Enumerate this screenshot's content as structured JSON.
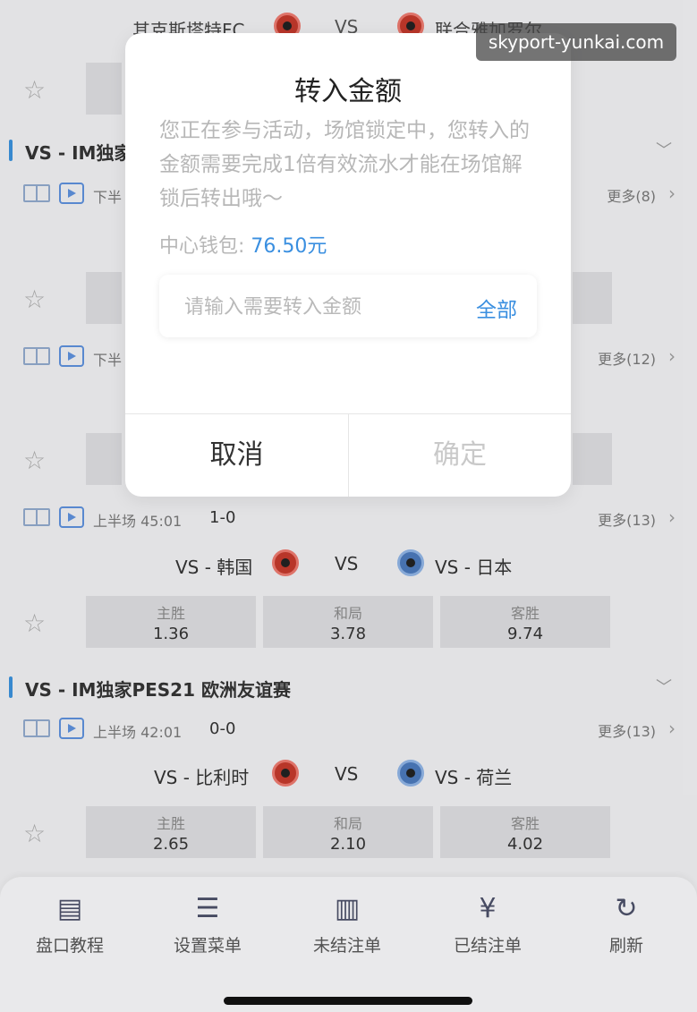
{
  "watermark": "skyport-yunkai.com",
  "top_match": {
    "home": "其克斯塔特FC",
    "vs": "VS",
    "away": "联合雅加罗尔"
  },
  "leagues": [
    {
      "name": "VS - IM独家"
    },
    {
      "name": "VS - IM独家PES21 欧洲友谊赛"
    }
  ],
  "rows": [
    {
      "period": "下半",
      "more": "更多(8)"
    },
    {
      "period": "下半",
      "more": "更多(12)"
    }
  ],
  "match1": {
    "period": "上半场 45:01",
    "score": "1-0",
    "more": "更多(13)",
    "home": "VS - 韩国",
    "vs": "VS",
    "away": "VS - 日本",
    "odds": [
      {
        "label": "主胜",
        "value": "1.36"
      },
      {
        "label": "和局",
        "value": "3.78"
      },
      {
        "label": "客胜",
        "value": "9.74"
      }
    ]
  },
  "match2": {
    "period": "上半场 42:01",
    "score": "0-0",
    "more": "更多(13)",
    "home": "VS - 比利时",
    "vs": "VS",
    "away": "VS - 荷兰",
    "odds": [
      {
        "label": "主胜",
        "value": "2.65"
      },
      {
        "label": "和局",
        "value": "2.10"
      },
      {
        "label": "客胜",
        "value": "4.02"
      }
    ]
  },
  "modal": {
    "title": "转入金额",
    "message": "您正在参与活动，场馆锁定中，您转入的金额需要完成1倍有效流水才能在场馆解锁后转出哦～",
    "wallet_label": "中心钱包:",
    "wallet_amount": "76.50元",
    "input_placeholder": "请输入需要转入金额",
    "all_label": "全部",
    "cancel_label": "取消",
    "confirm_label": "确定"
  },
  "bottom_nav": [
    {
      "label": "盘口教程",
      "icon": "document-icon"
    },
    {
      "label": "设置菜单",
      "icon": "sliders-icon"
    },
    {
      "label": "未结注单",
      "icon": "clipboard-icon"
    },
    {
      "label": "已结注单",
      "icon": "yen-clipboard-icon"
    },
    {
      "label": "刷新",
      "icon": "refresh-icon"
    }
  ]
}
